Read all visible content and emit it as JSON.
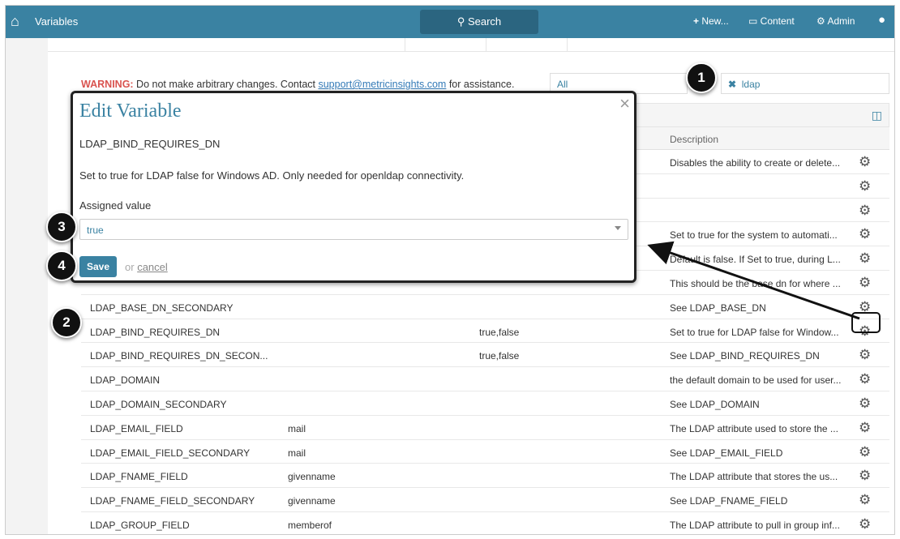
{
  "topbar": {
    "title": "Variables",
    "search": "Search",
    "new": "New...",
    "content": "Content",
    "admin": "Admin"
  },
  "warning": {
    "label": "WARNING:",
    "text": " Do not make arbitrary changes. Contact ",
    "email": "support@metricinsights.com",
    "suffix": " for assistance."
  },
  "filters": {
    "type": "All",
    "search": "ldap"
  },
  "table": {
    "description_header": "Description",
    "rows": [
      {
        "name": "",
        "value": "",
        "allowed": "",
        "desc": "Disables the ability to create or delete..."
      },
      {
        "name": "",
        "value": "",
        "allowed": "",
        "desc": ""
      },
      {
        "name": "",
        "value": "",
        "allowed": "",
        "desc": ""
      },
      {
        "name": "",
        "value": "",
        "allowed": "",
        "desc": "Set to true for the system to automati..."
      },
      {
        "name": "",
        "value": "",
        "allowed": "",
        "desc": "Default is false. If Set to true, during L..."
      },
      {
        "name": "",
        "value": "",
        "allowed": "",
        "desc": "This should be the base dn for where ..."
      },
      {
        "name": "LDAP_BASE_DN_SECONDARY",
        "value": "",
        "allowed": "",
        "desc": "See LDAP_BASE_DN"
      },
      {
        "name": "LDAP_BIND_REQUIRES_DN",
        "value": "",
        "allowed": "true,false",
        "desc": "Set to true for LDAP false for Window..."
      },
      {
        "name": "LDAP_BIND_REQUIRES_DN_SECON...",
        "value": "",
        "allowed": "true,false",
        "desc": "See LDAP_BIND_REQUIRES_DN"
      },
      {
        "name": "LDAP_DOMAIN",
        "value": "",
        "allowed": "",
        "desc": "the default domain to be used for user..."
      },
      {
        "name": "LDAP_DOMAIN_SECONDARY",
        "value": "",
        "allowed": "",
        "desc": "See LDAP_DOMAIN"
      },
      {
        "name": "LDAP_EMAIL_FIELD",
        "value": "mail",
        "allowed": "",
        "desc": "The LDAP attribute used to store the ..."
      },
      {
        "name": "LDAP_EMAIL_FIELD_SECONDARY",
        "value": "mail",
        "allowed": "",
        "desc": "See LDAP_EMAIL_FIELD"
      },
      {
        "name": "LDAP_FNAME_FIELD",
        "value": "givenname",
        "allowed": "",
        "desc": "The LDAP attribute that stores the us..."
      },
      {
        "name": "LDAP_FNAME_FIELD_SECONDARY",
        "value": "givenname",
        "allowed": "",
        "desc": "See LDAP_FNAME_FIELD"
      },
      {
        "name": "LDAP_GROUP_FIELD",
        "value": "memberof",
        "allowed": "",
        "desc": "The LDAP attribute to pull in group inf..."
      }
    ]
  },
  "modal": {
    "title": "Edit Variable",
    "var_name": "LDAP_BIND_REQUIRES_DN",
    "description": "Set to true for LDAP false for Windows AD. Only needed for openldap connectivity.",
    "assigned_label": "Assigned value",
    "assigned_value": "true",
    "save": "Save",
    "or": "or",
    "cancel": "cancel"
  },
  "callouts": [
    "1",
    "2",
    "3",
    "4"
  ]
}
